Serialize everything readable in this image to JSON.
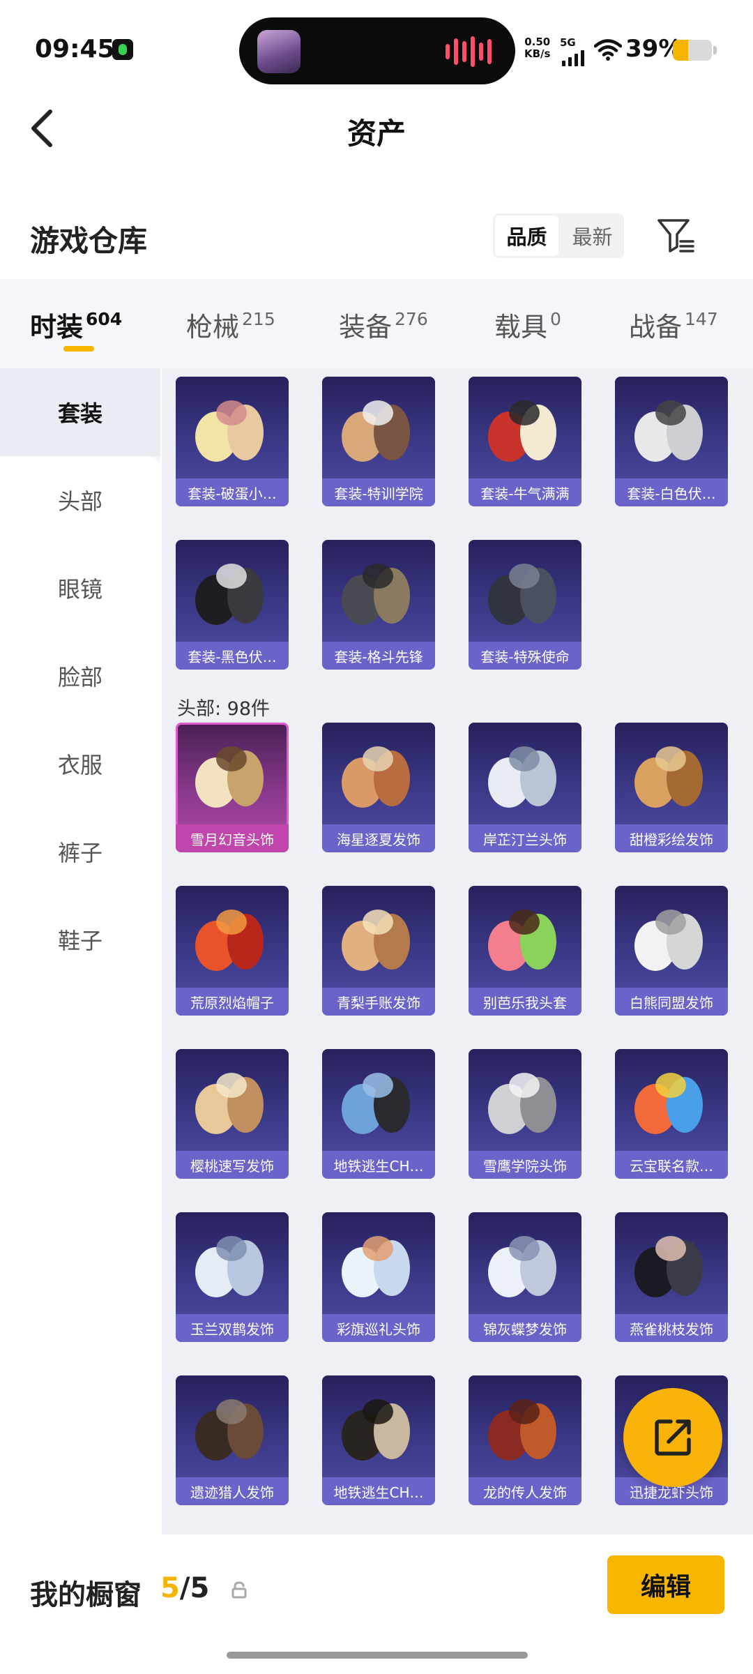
{
  "status_bar": {
    "time": "09:45",
    "net_speed_value": "0.50",
    "net_speed_unit": "KB/s",
    "network": "5G",
    "battery_pct": "39%",
    "battery_level": 0.39,
    "battery_color": "#f5b400",
    "icons": [
      "app-notification-icon",
      "audio-wave-icon",
      "signal-icon",
      "wifi-icon",
      "battery-icon"
    ]
  },
  "nav": {
    "title": "资产",
    "back_icon": "chevron-left-icon"
  },
  "warehouse": {
    "title": "游戏仓库",
    "sort_options": [
      "品质",
      "最新"
    ],
    "sort_selected": "品质",
    "filter_icon": "filter-icon"
  },
  "tabs": [
    {
      "label": "时装",
      "count": "604"
    },
    {
      "label": "枪械",
      "count": "215"
    },
    {
      "label": "装备",
      "count": "276"
    },
    {
      "label": "载具",
      "count": "0"
    },
    {
      "label": "战备",
      "count": "147"
    }
  ],
  "tab_selected": "时装",
  "sidebar": {
    "items": [
      "套装",
      "头部",
      "眼镜",
      "脸部",
      "衣服",
      "裤子",
      "鞋子"
    ],
    "selected": "套装"
  },
  "sections": {
    "suits": [
      "套装-破蛋小…",
      "套装-特训学院",
      "套装-牛气满满",
      "套装-白色伏…",
      "套装-黑色伏…",
      "套装-格斗先锋",
      "套装-特殊使命"
    ],
    "head_label": "头部: 98件",
    "head": [
      "雪月幻音头饰",
      "海星逐夏发饰",
      "岸芷汀兰头饰",
      "甜橙彩绘发饰",
      "荒原烈焰帽子",
      "青梨手账发饰",
      "别芭乐我头套",
      "白熊同盟发饰",
      "樱桃速写发饰",
      "地铁逃生CH…",
      "雪鹰学院头饰",
      "云宝联名款…",
      "玉兰双鹊发饰",
      "彩旗巡礼头饰",
      "锦灰蝶梦发饰",
      "燕雀桃枝发饰",
      "遗迹猎人发饰",
      "地铁逃生CH…",
      "龙的传人发饰",
      "迅捷龙虾头饰"
    ]
  },
  "colors": {
    "accent": "#f5b400",
    "card_rare": "#6a63c9",
    "card_legendary": "#c046ad"
  },
  "fab_icon": "share-external-icon",
  "bottom": {
    "label": "我的橱窗",
    "current": "5",
    "total": "/5",
    "lock_icon": "lock-icon",
    "edit": "编辑"
  }
}
